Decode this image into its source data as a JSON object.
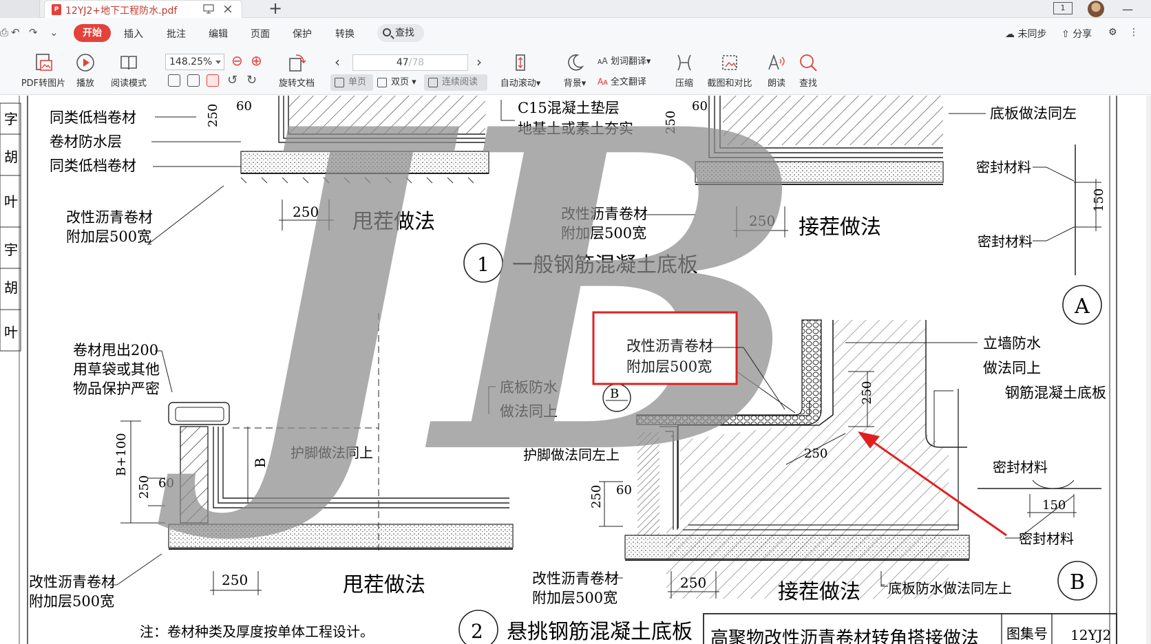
{
  "tab": {
    "title": "12YJ2+地下工程防水.pdf",
    "page_count_badge": "1"
  },
  "menu": {
    "start": "开始",
    "insert": "插入",
    "annotate": "批注",
    "edit": "编辑",
    "page": "页面",
    "protect": "保护",
    "convert": "转换",
    "search": "查找",
    "sync": "未同步",
    "share": "分享"
  },
  "ribbon": {
    "pdf_to_image": "PDF转图片",
    "play": "播放",
    "read_mode": "阅读模式",
    "zoom": "148.25%",
    "rotate": "旋转文档",
    "page_current": "47",
    "page_total": "/78",
    "single": "单页",
    "double": "双页",
    "continuous": "连续阅读",
    "auto_scroll": "自动滚动",
    "background": "背景",
    "word_translate": "划词翻译",
    "full_translate": "全文翻译",
    "compress": "压缩",
    "screenshot_compare": "截图和对比",
    "read_aloud": "朗读",
    "find": "查找"
  },
  "drawing": {
    "watermark": "JB",
    "side": [
      "字",
      "胡",
      "叶",
      "宇",
      "胡",
      "叶"
    ],
    "lbl_tong1": "同类低档卷材",
    "lbl_juancai": "卷材防水层",
    "lbl_tong2": "同类低档卷材",
    "lbl_c15": "C15混凝土垫层",
    "lbl_dijitu": "地基土或素土夯实",
    "lbl_dibanzuofa_tongzuo": "底板做法同左",
    "lbl_gaixing_a": "改性沥青卷材",
    "lbl_fujia_a": "附加层500宽",
    "lbl_gaixing_b": "改性沥青卷材",
    "lbl_fujia_b": "附加层500宽",
    "lbl_shuacha1": "甩茬做法",
    "lbl_jiecha1": "接茬做法",
    "title1": "一般钢筋混凝土底板",
    "num1": "1",
    "lbl_mifeng1": "密封材料",
    "lbl_mifeng2": "密封材料",
    "dim_150a": "150",
    "circle_a": "A",
    "lbl_juancai_shuai1": "卷材甩出200",
    "lbl_juancai_shuai2": "用草袋或其他",
    "lbl_juancai_shuai3": "物品保护严密",
    "box_gaixing": "改性沥青卷材",
    "box_fujia": "附加层500宽",
    "lbl_diban1": "底板防水",
    "lbl_diban2": "做法同上",
    "lbl_hujiao1": "护脚做法同上",
    "lbl_hujiao2": "护脚做法同左上",
    "lbl_liqiang1": "立墙防水",
    "lbl_liqiang2": "做法同上",
    "lbl_gangjin": "钢筋混凝土底板",
    "detail_b": "B",
    "lbl_mifeng3": "密封材料",
    "dim_150b": "150",
    "lbl_mifeng4": "密封材料",
    "circle_b": "B",
    "dim_250": "250",
    "dim_60": "60",
    "dim_b100": "B+100",
    "dim_b": "B",
    "lbl_gaixing_c": "改性沥青卷材",
    "lbl_fujia_c": "附加层500宽",
    "lbl_gaixing_d": "改性沥青卷材",
    "lbl_fujia_d": "附加层500宽",
    "lbl_shuacha2": "甩茬做法",
    "lbl_jiecha2": "接茬做法",
    "lbl_dibanfangshui": "底板防水做法同左上",
    "title2": "悬挑钢筋混凝土底板",
    "num2": "2",
    "note": "注：卷材种类及厚度按单体工程设计。",
    "title_block": "高聚物改性沥青卷材转角搭接做法",
    "atlas_label": "图集号",
    "atlas_no": "12YJ2"
  },
  "colors": {
    "accent": "#e5413b",
    "annotation": "#e02020",
    "watermark": "#8c8c8c"
  }
}
